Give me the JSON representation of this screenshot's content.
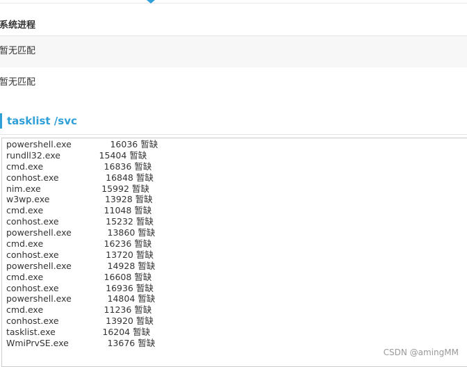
{
  "section": {
    "title": "系统进程",
    "rows": [
      "暂无匹配",
      "暂无匹配"
    ]
  },
  "command": {
    "heading": "tasklist /svc",
    "output_lines": [
      "powershell.exe              16036 暂缺",
      "rundll32.exe              15404 暂缺",
      "cmd.exe                      16836 暂缺",
      "conhost.exe                 16848 暂缺",
      "nim.exe                      15992 暂缺",
      "w3wp.exe                    13928 暂缺",
      "cmd.exe                      11048 暂缺",
      "conhost.exe                 15232 暂缺",
      "powershell.exe             13860 暂缺",
      "cmd.exe                      16236 暂缺",
      "conhost.exe                 13720 暂缺",
      "powershell.exe             14928 暂缺",
      "cmd.exe                      16608 暂缺",
      "conhost.exe                 16936 暂缺",
      "powershell.exe             14804 暂缺",
      "cmd.exe                      11236 暂缺",
      "conhost.exe                 13920 暂缺",
      "tasklist.exe                 16204 暂缺",
      "WmiPrvSE.exe              13676 暂缺"
    ]
  },
  "watermark": "CSDN @amingMM",
  "colors": {
    "accent": "#2f9fd8",
    "text": "#333333",
    "row_alt": "#f7f7f7"
  }
}
